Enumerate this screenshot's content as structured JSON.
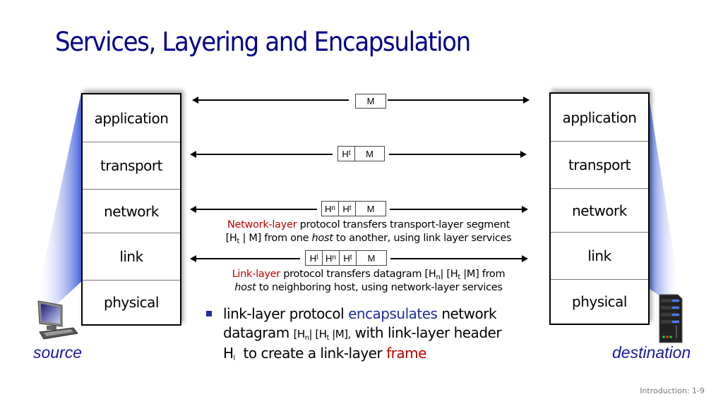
{
  "slide": {
    "title": "Services, Layering and Encapsulation",
    "footer": "Introduction: 1-9"
  },
  "source": {
    "label": "source",
    "icon": "desktop-computer-icon",
    "layers": [
      "application",
      "transport",
      "network",
      "link",
      "physical"
    ]
  },
  "destination": {
    "label": "destination",
    "icon": "server-icon",
    "layers": [
      "application",
      "transport",
      "network",
      "link",
      "physical"
    ]
  },
  "packets": {
    "application": {
      "M": "M"
    },
    "transport": {
      "Ht": "H",
      "Ht_sub": "t",
      "M": "M"
    },
    "network": {
      "Hn": "H",
      "Hn_sub": "n",
      "Ht": "H",
      "Ht_sub": "t",
      "M": "M"
    },
    "link": {
      "Hl": "H",
      "Hl_sub": "l",
      "Hn": "H",
      "Hn_sub": "n",
      "Ht": "H",
      "Ht_sub": "t",
      "M": "M"
    }
  },
  "network_desc": {
    "highlight": "Network-layer",
    "line1_rest": " protocol transfers transport-layer segment",
    "line2_a": "[H",
    "line2_sub": "t",
    "line2_b": " | M] from one ",
    "line2_italic": "host",
    "line2_c": " to another, using link layer services"
  },
  "link_desc": {
    "highlight": "Link-layer",
    "line1_a": " protocol transfers datagram [H",
    "line1_sub1": "n",
    "line1_b": "| [H",
    "line1_sub2": "t",
    "line1_c": " |M] from",
    "line2_italic": "host",
    "line2_rest": " to neighboring host, using network-layer services"
  },
  "bullet": {
    "p1": "link-layer protocol ",
    "p1_highlight": "encapsulates",
    "p1_rest": " network",
    "p2_a": "datagram ",
    "p2_small_a": "[H",
    "p2_sub1": "n",
    "p2_small_b": "| [H",
    "p2_sub2": "t",
    "p2_small_c": " |M],",
    "p2_rest": " with link-layer header",
    "p3_a": "H",
    "p3_sub": "l",
    "p3_b": "  to create a link-layer ",
    "p3_highlight": "frame"
  },
  "colors": {
    "title": "#00008b",
    "highlight_red": "#c00000",
    "highlight_blue": "#1f2ea0",
    "node_label": "#1a1aa0"
  }
}
